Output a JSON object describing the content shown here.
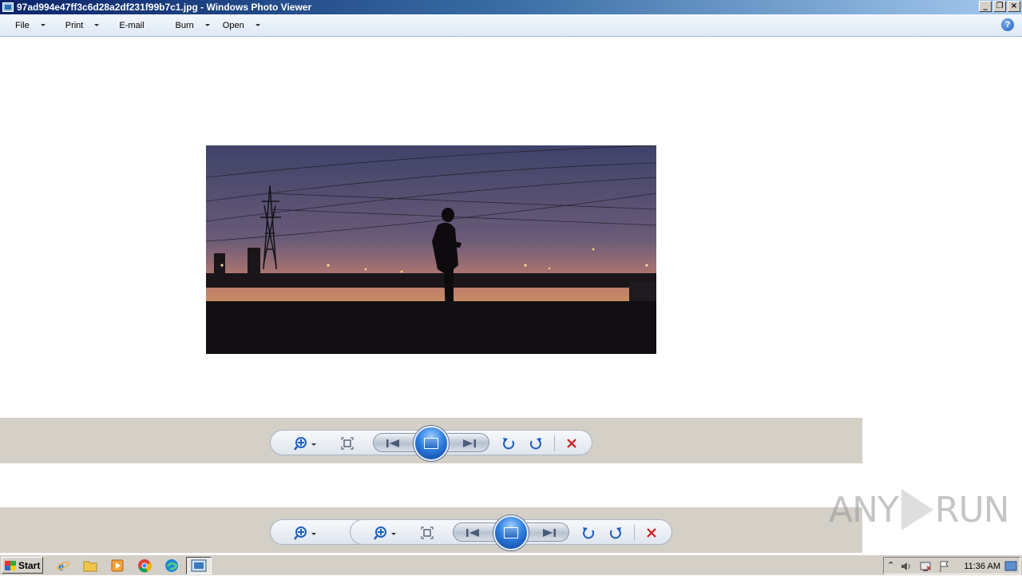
{
  "window": {
    "title": "97ad994e47ff3c6d28a2df231f99b7c1.jpg - Windows Photo Viewer",
    "controls": {
      "minimize": "_",
      "restore": "❐",
      "close": "×"
    }
  },
  "menu": {
    "items": [
      {
        "label": "File",
        "has_dropdown": true
      },
      {
        "label": "Print",
        "has_dropdown": true
      },
      {
        "label": "E-mail",
        "has_dropdown": false
      },
      {
        "label": "Burn",
        "has_dropdown": true
      },
      {
        "label": "Open",
        "has_dropdown": true
      }
    ],
    "help": "?"
  },
  "toolbar": {
    "buttons": [
      "zoom-icon",
      "fit-to-window-icon",
      "previous-icon",
      "slideshow-icon",
      "next-icon",
      "rotate-counterclockwise-icon",
      "rotate-clockwise-icon",
      "delete-icon"
    ],
    "colors": {
      "icon_blue": "#1f5fbf",
      "delete_red": "#d01c1c"
    }
  },
  "watermark": {
    "left": "ANY",
    "right": "RUN"
  },
  "taskbar": {
    "start_label": "Start",
    "pinned": [
      "internet-explorer-icon",
      "folder-icon",
      "media-player-icon",
      "chrome-icon",
      "edge-icon",
      "photo-viewer-icon"
    ],
    "clock": "11:36 AM"
  }
}
